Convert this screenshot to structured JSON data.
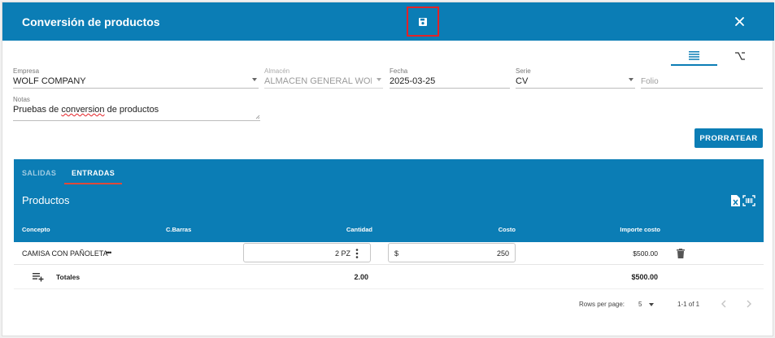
{
  "dialog": {
    "title": "Conversión de productos",
    "save_icon": "save-icon",
    "close_icon": "close-icon"
  },
  "view_tabs": [
    {
      "icon": "list-view-icon",
      "active": true
    },
    {
      "icon": "function-icon",
      "active": false
    }
  ],
  "form": {
    "empresa": {
      "label": "Empresa",
      "value": "WOLF COMPANY"
    },
    "almacen": {
      "label": "Almacén",
      "value": "ALMACEN GENERAL WOLF C"
    },
    "fecha": {
      "label": "Fecha",
      "value": "2025-03-25"
    },
    "serie": {
      "label": "Serie",
      "value": "CV"
    },
    "folio": {
      "placeholder": "Folio"
    },
    "notas": {
      "label": "Notas",
      "value_before": "Pruebas de ",
      "value_misspelled": "conversion",
      "value_after": " de productos"
    }
  },
  "prorratear_label": "PRORRATEAR",
  "panel": {
    "tabs": [
      {
        "label": "SALIDAS",
        "active": false
      },
      {
        "label": "ENTRADAS",
        "active": true
      }
    ],
    "title": "Productos",
    "columns": {
      "concepto": "Concepto",
      "barras": "C.Barras",
      "cantidad": "Cantidad",
      "costo": "Costo",
      "importe": "Importe costo"
    }
  },
  "rows": [
    {
      "concepto": "CAMISA CON PAÑOLETA",
      "more": "•••",
      "cantidad": "2 PZ",
      "costo_prefix": "$",
      "costo": "250",
      "importe": "$500.00"
    }
  ],
  "totals": {
    "label": "Totales",
    "cantidad": "2.00",
    "importe": "$500.00"
  },
  "pagination": {
    "rows_per_page_label": "Rows per page:",
    "rows_per_page": "5",
    "range": "1-1 of 1"
  },
  "colors": {
    "primary": "#0b7db5",
    "highlight": "#e32227"
  }
}
